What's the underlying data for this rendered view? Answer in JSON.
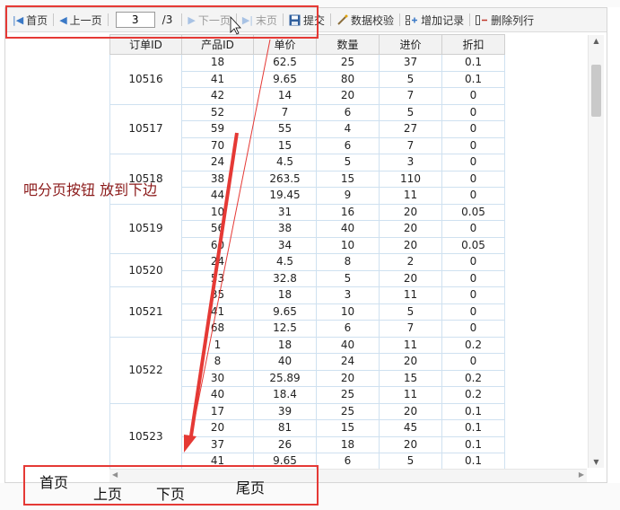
{
  "toolbar": {
    "first": "首页",
    "prev": "上一页",
    "page_value": "3",
    "page_total": "/3",
    "next": "下一页",
    "last": "末页",
    "submit": "提交",
    "validate": "数据校验",
    "add_record": "增加记录",
    "delete_row": "删除列行"
  },
  "grid": {
    "headers": [
      "订单ID",
      "产品ID",
      "单价",
      "数量",
      "进价",
      "折扣"
    ],
    "groups": [
      {
        "order_id": "10516",
        "rows": [
          [
            "18",
            "62.5",
            "25",
            "37",
            "0.1"
          ],
          [
            "41",
            "9.65",
            "80",
            "5",
            "0.1"
          ],
          [
            "42",
            "14",
            "20",
            "7",
            "0"
          ]
        ]
      },
      {
        "order_id": "10517",
        "rows": [
          [
            "52",
            "7",
            "6",
            "5",
            "0"
          ],
          [
            "59",
            "55",
            "4",
            "27",
            "0"
          ],
          [
            "70",
            "15",
            "6",
            "7",
            "0"
          ]
        ]
      },
      {
        "order_id": "10518",
        "rows": [
          [
            "24",
            "4.5",
            "5",
            "3",
            "0"
          ],
          [
            "38",
            "263.5",
            "15",
            "110",
            "0"
          ],
          [
            "44",
            "19.45",
            "9",
            "11",
            "0"
          ]
        ]
      },
      {
        "order_id": "10519",
        "rows": [
          [
            "10",
            "31",
            "16",
            "20",
            "0.05"
          ],
          [
            "56",
            "38",
            "40",
            "20",
            "0"
          ],
          [
            "60",
            "34",
            "10",
            "20",
            "0.05"
          ]
        ]
      },
      {
        "order_id": "10520",
        "rows": [
          [
            "24",
            "4.5",
            "8",
            "2",
            "0"
          ],
          [
            "53",
            "32.8",
            "5",
            "20",
            "0"
          ]
        ]
      },
      {
        "order_id": "10521",
        "rows": [
          [
            "35",
            "18",
            "3",
            "11",
            "0"
          ],
          [
            "41",
            "9.65",
            "10",
            "5",
            "0"
          ],
          [
            "68",
            "12.5",
            "6",
            "7",
            "0"
          ]
        ]
      },
      {
        "order_id": "10522",
        "rows": [
          [
            "1",
            "18",
            "40",
            "11",
            "0.2"
          ],
          [
            "8",
            "40",
            "24",
            "20",
            "0"
          ],
          [
            "30",
            "25.89",
            "20",
            "15",
            "0.2"
          ],
          [
            "40",
            "18.4",
            "25",
            "11",
            "0.2"
          ]
        ]
      },
      {
        "order_id": "10523",
        "rows": [
          [
            "17",
            "39",
            "25",
            "20",
            "0.1"
          ],
          [
            "20",
            "81",
            "15",
            "45",
            "0.1"
          ],
          [
            "37",
            "26",
            "18",
            "20",
            "0.1"
          ],
          [
            "41",
            "9.65",
            "6",
            "5",
            "0.1"
          ]
        ]
      }
    ]
  },
  "annotation": {
    "note": "吧分页按钮 放到下边",
    "first": "首页",
    "prev": "上页",
    "next": "下页",
    "last": "尾页",
    "color": "#e53935"
  }
}
